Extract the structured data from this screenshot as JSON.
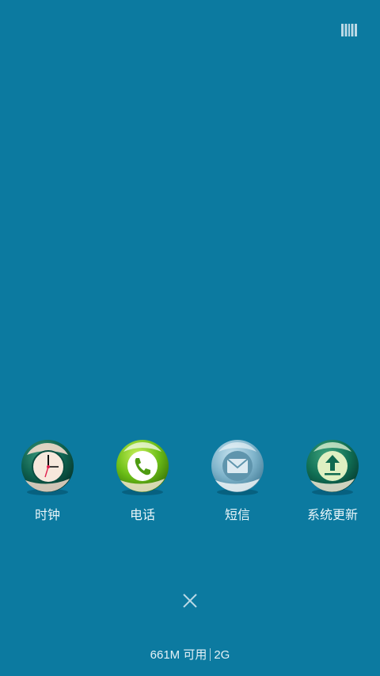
{
  "apps": [
    {
      "label": "时钟",
      "icon": "clock-icon"
    },
    {
      "label": "电话",
      "icon": "phone-icon"
    },
    {
      "label": "短信",
      "icon": "message-icon"
    },
    {
      "label": "系统更新",
      "icon": "system-update-icon"
    }
  ],
  "status": {
    "memory": "661M 可用",
    "total": "2G"
  },
  "colors": {
    "background": "#0c7aa0",
    "label": "#e9f5f9"
  }
}
